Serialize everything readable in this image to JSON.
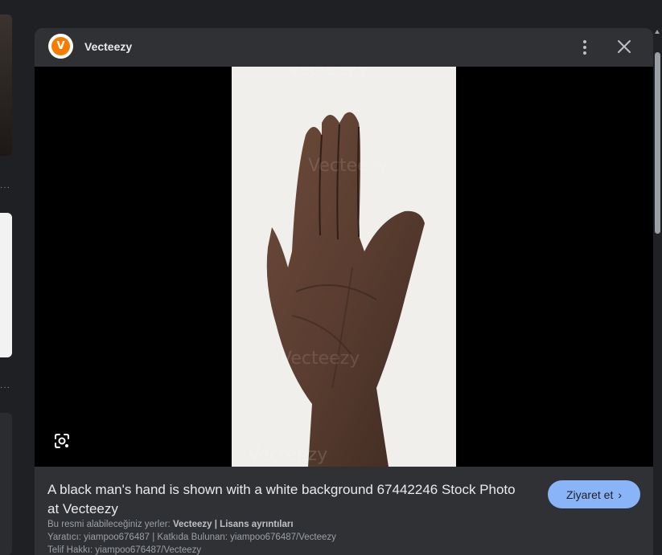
{
  "source": {
    "name": "Vecteezy",
    "logo_letter": "V"
  },
  "image": {
    "subject": "hand",
    "watermark": "Vecteezy"
  },
  "info": {
    "title": "A black man's hand is shown with a white background 67442246 Stock Photo at Vecteezy",
    "available_at_prefix": "Bu resmi alabileceğiniz yerler: ",
    "available_site": "Vecteezy",
    "separator": " | ",
    "license_link": "Lisans ayrıntıları",
    "creator_line": "Yaratıcı: yiampoo676487 | Katkıda Bulunan: yiampoo676487/Vecteezy",
    "copyright_line": "Telif Hakkı: yiampoo676487/Vecteezy"
  },
  "actions": {
    "visit_label": "Ziyaret et",
    "visit_chevron": "›"
  },
  "icons": {
    "more": "more-vert-icon",
    "close": "close-icon",
    "lens": "google-lens-icon"
  },
  "colors": {
    "panel_bg": "#303134",
    "page_bg": "#1f2023",
    "accent_button": "#8ab4f8",
    "logo_orange": "#f57c00"
  }
}
